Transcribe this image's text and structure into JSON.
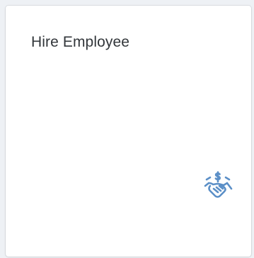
{
  "tile": {
    "title": "Hire Employee",
    "icon": "handshake-money-icon",
    "icon_color": "#5b8fc7"
  }
}
